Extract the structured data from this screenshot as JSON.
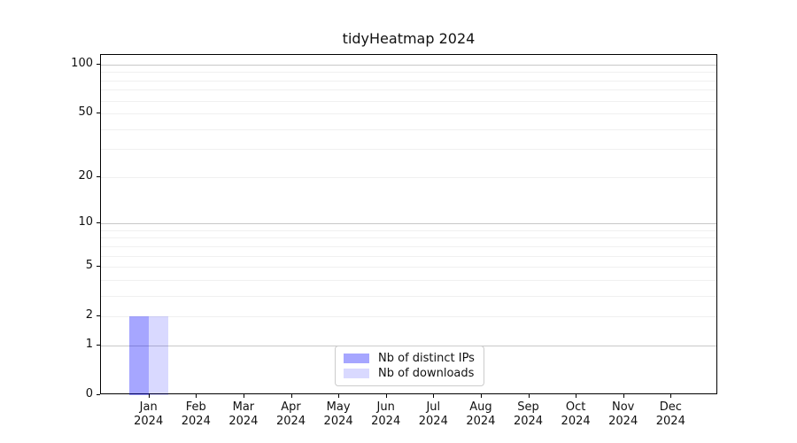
{
  "chart_data": {
    "type": "bar",
    "title": "tidyHeatmap 2024",
    "categories": [
      "Jan 2024",
      "Feb 2024",
      "Mar 2024",
      "Apr 2024",
      "May 2024",
      "Jun 2024",
      "Jul 2024",
      "Aug 2024",
      "Sep 2024",
      "Oct 2024",
      "Nov 2024",
      "Dec 2024"
    ],
    "series": [
      {
        "name": "Nb of distinct IPs",
        "color": "rgba(0,0,255,0.35)",
        "values": [
          2,
          0,
          0,
          0,
          0,
          0,
          0,
          0,
          0,
          0,
          0,
          0
        ]
      },
      {
        "name": "Nb of downloads",
        "color": "rgba(0,0,255,0.15)",
        "values": [
          2,
          0,
          0,
          0,
          0,
          0,
          0,
          0,
          0,
          0,
          0,
          0
        ]
      }
    ],
    "xlabel": "",
    "ylabel": "",
    "yscale": "log(value+1)",
    "ylim": [
      0,
      114
    ],
    "y_ticks": [
      0,
      1,
      2,
      5,
      10,
      20,
      50,
      100
    ],
    "y_major_gridlines": [
      1,
      10,
      100
    ],
    "y_minor_gridlines": [
      2,
      3,
      4,
      5,
      6,
      7,
      8,
      9,
      20,
      30,
      40,
      50,
      60,
      70,
      80,
      90
    ],
    "grid": true,
    "legend_position": "bottom-center",
    "colors": {
      "bar_distinct_ips": "#a6a6ff",
      "bar_downloads": "#d9d9ff",
      "major_grid": "#c8c8c8",
      "minor_grid": "#f0f0f0",
      "spine": "#000000",
      "text": "#111111",
      "legend_border": "#cccccc"
    }
  }
}
